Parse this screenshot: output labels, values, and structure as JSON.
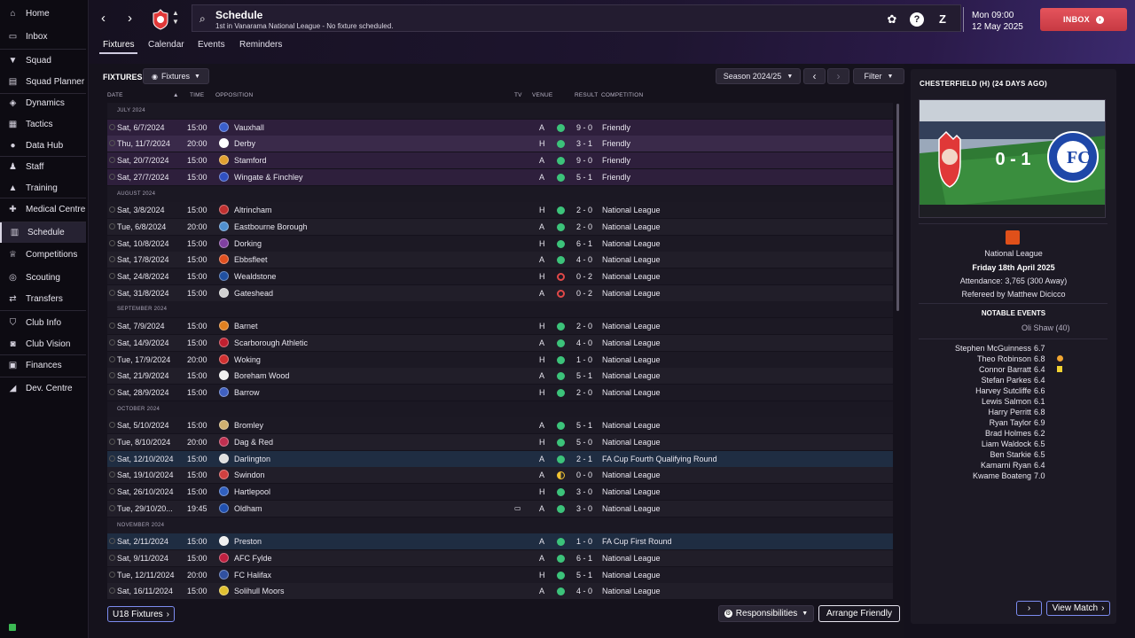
{
  "sidebar": {
    "items": [
      {
        "label": "Home",
        "icon": "home-icon",
        "glyph": "⌂"
      },
      {
        "label": "Inbox",
        "icon": "inbox-icon",
        "glyph": "▭"
      },
      {
        "label": "Squad",
        "icon": "shirt-icon",
        "glyph": "▼"
      },
      {
        "label": "Squad Planner",
        "icon": "clipboard-icon",
        "glyph": "▤"
      },
      {
        "label": "Dynamics",
        "icon": "dynamics-icon",
        "glyph": "◈"
      },
      {
        "label": "Tactics",
        "icon": "tactics-icon",
        "glyph": "▦"
      },
      {
        "label": "Data Hub",
        "icon": "data-hub-icon",
        "glyph": "●"
      },
      {
        "label": "Staff",
        "icon": "staff-icon",
        "glyph": "♟"
      },
      {
        "label": "Training",
        "icon": "training-icon",
        "glyph": "▲"
      },
      {
        "label": "Medical Centre",
        "icon": "medical-icon",
        "glyph": "✚"
      },
      {
        "label": "Schedule",
        "icon": "calendar-icon",
        "glyph": "▥"
      },
      {
        "label": "Competitions",
        "icon": "trophy-icon",
        "glyph": "♕"
      },
      {
        "label": "Scouting",
        "icon": "scouting-icon",
        "glyph": "◎"
      },
      {
        "label": "Transfers",
        "icon": "transfers-icon",
        "glyph": "⇄"
      },
      {
        "label": "Club Info",
        "icon": "shield-icon",
        "glyph": "⛉"
      },
      {
        "label": "Club Vision",
        "icon": "vision-icon",
        "glyph": "◙"
      },
      {
        "label": "Finances",
        "icon": "finances-icon",
        "glyph": "▣"
      },
      {
        "label": "Dev. Centre",
        "icon": "dev-centre-icon",
        "glyph": "◢"
      }
    ]
  },
  "header": {
    "title": "Schedule",
    "subtitle": "1st in Vanarama National League - No fixture scheduled.",
    "day_time": "Mon 09:00",
    "date": "12 May 2025",
    "inbox_label": "INBOX",
    "tabs": [
      "Fixtures",
      "Calendar",
      "Events",
      "Reminders"
    ]
  },
  "toolbar": {
    "section_label": "FIXTURES",
    "view_dropdown": "Fixtures",
    "season": "Season 2024/25",
    "filter": "Filter"
  },
  "columns": {
    "date": "DATE",
    "time": "TIME",
    "opposition": "OPPOSITION",
    "tv": "TV",
    "venue": "VENUE",
    "result": "RESULT",
    "competition": "COMPETITION"
  },
  "fixtures": [
    {
      "month": "JULY 2024"
    },
    {
      "date": "Sat, 6/7/2024",
      "time": "15:00",
      "opp": "Vauxhall",
      "venue": "A",
      "res": "W",
      "score": "9 - 0",
      "comp": "Friendly",
      "style": "friendly",
      "color": "#3a5fcc"
    },
    {
      "date": "Thu, 11/7/2024",
      "time": "20:00",
      "opp": "Derby",
      "venue": "H",
      "res": "W",
      "score": "3 - 1",
      "comp": "Friendly",
      "style": "friendly2",
      "color": "#ffffff"
    },
    {
      "date": "Sat, 20/7/2024",
      "time": "15:00",
      "opp": "Stamford",
      "venue": "A",
      "res": "W",
      "score": "9 - 0",
      "comp": "Friendly",
      "style": "friendly",
      "color": "#e0a030"
    },
    {
      "date": "Sat, 27/7/2024",
      "time": "15:00",
      "opp": "Wingate & Finchley",
      "venue": "A",
      "res": "W",
      "score": "5 - 1",
      "comp": "Friendly",
      "style": "friendly",
      "color": "#3050c0"
    },
    {
      "month": "AUGUST 2024"
    },
    {
      "date": "Sat, 3/8/2024",
      "time": "15:00",
      "opp": "Altrincham",
      "venue": "H",
      "res": "W",
      "score": "2 - 0",
      "comp": "National League",
      "style": "dark",
      "color": "#c03030"
    },
    {
      "date": "Tue, 6/8/2024",
      "time": "20:00",
      "opp": "Eastbourne Borough",
      "venue": "A",
      "res": "W",
      "score": "2 - 0",
      "comp": "National League",
      "style": "alt",
      "color": "#5090d0"
    },
    {
      "date": "Sat, 10/8/2024",
      "time": "15:00",
      "opp": "Dorking",
      "venue": "H",
      "res": "W",
      "score": "6 - 1",
      "comp": "National League",
      "style": "dark",
      "color": "#8040a0"
    },
    {
      "date": "Sat, 17/8/2024",
      "time": "15:00",
      "opp": "Ebbsfleet",
      "venue": "A",
      "res": "W",
      "score": "4 - 0",
      "comp": "National League",
      "style": "alt",
      "color": "#e05020"
    },
    {
      "date": "Sat, 24/8/2024",
      "time": "15:00",
      "opp": "Wealdstone",
      "venue": "H",
      "res": "L",
      "score": "0 - 2",
      "comp": "National League",
      "style": "dark",
      "color": "#2050a0"
    },
    {
      "date": "Sat, 31/8/2024",
      "time": "15:00",
      "opp": "Gateshead",
      "venue": "A",
      "res": "L",
      "score": "0 - 2",
      "comp": "National League",
      "style": "alt",
      "color": "#d0d0d0"
    },
    {
      "month": "SEPTEMBER 2024"
    },
    {
      "date": "Sat, 7/9/2024",
      "time": "15:00",
      "opp": "Barnet",
      "venue": "H",
      "res": "W",
      "score": "2 - 0",
      "comp": "National League",
      "style": "dark",
      "color": "#e08020"
    },
    {
      "date": "Sat, 14/9/2024",
      "time": "15:00",
      "opp": "Scarborough Athletic",
      "venue": "A",
      "res": "W",
      "score": "4 - 0",
      "comp": "National League",
      "style": "alt",
      "color": "#c02030"
    },
    {
      "date": "Tue, 17/9/2024",
      "time": "20:00",
      "opp": "Woking",
      "venue": "H",
      "res": "W",
      "score": "1 - 0",
      "comp": "National League",
      "style": "dark",
      "color": "#d03030"
    },
    {
      "date": "Sat, 21/9/2024",
      "time": "15:00",
      "opp": "Boreham Wood",
      "venue": "A",
      "res": "W",
      "score": "5 - 1",
      "comp": "National League",
      "style": "alt",
      "color": "#f0f0f0"
    },
    {
      "date": "Sat, 28/9/2024",
      "time": "15:00",
      "opp": "Barrow",
      "venue": "H",
      "res": "W",
      "score": "2 - 0",
      "comp": "National League",
      "style": "dark",
      "color": "#4060c0"
    },
    {
      "month": "OCTOBER 2024"
    },
    {
      "date": "Sat, 5/10/2024",
      "time": "15:00",
      "opp": "Bromley",
      "venue": "A",
      "res": "W",
      "score": "5 - 1",
      "comp": "National League",
      "style": "dark",
      "color": "#d0b070"
    },
    {
      "date": "Tue, 8/10/2024",
      "time": "20:00",
      "opp": "Dag & Red",
      "venue": "H",
      "res": "W",
      "score": "5 - 0",
      "comp": "National League",
      "style": "alt",
      "color": "#c03050"
    },
    {
      "date": "Sat, 12/10/2024",
      "time": "15:00",
      "opp": "Darlington",
      "venue": "A",
      "res": "W",
      "score": "2 - 1",
      "comp": "FA Cup Fourth Qualifying Round",
      "style": "cup",
      "color": "#e0e0e0"
    },
    {
      "date": "Sat, 19/10/2024",
      "time": "15:00",
      "opp": "Swindon",
      "venue": "A",
      "res": "D",
      "score": "0 - 0",
      "comp": "National League",
      "style": "alt",
      "color": "#d04040"
    },
    {
      "date": "Sat, 26/10/2024",
      "time": "15:00",
      "opp": "Hartlepool",
      "venue": "H",
      "res": "W",
      "score": "3 - 0",
      "comp": "National League",
      "style": "dark",
      "color": "#3060c0"
    },
    {
      "date": "Tue, 29/10/20...",
      "time": "19:45",
      "opp": "Oldham",
      "venue": "A",
      "res": "W",
      "score": "3 - 0",
      "comp": "National League",
      "style": "alt",
      "color": "#2050b0",
      "tv": true
    },
    {
      "month": "NOVEMBER 2024"
    },
    {
      "date": "Sat, 2/11/2024",
      "time": "15:00",
      "opp": "Preston",
      "venue": "A",
      "res": "W",
      "score": "1 - 0",
      "comp": "FA Cup First Round",
      "style": "cup",
      "color": "#f0f0f0"
    },
    {
      "date": "Sat, 9/11/2024",
      "time": "15:00",
      "opp": "AFC Fylde",
      "venue": "A",
      "res": "W",
      "score": "6 - 1",
      "comp": "National League",
      "style": "alt",
      "color": "#c02040"
    },
    {
      "date": "Tue, 12/11/2024",
      "time": "20:00",
      "opp": "FC Halifax",
      "venue": "H",
      "res": "W",
      "score": "5 - 1",
      "comp": "National League",
      "style": "dark",
      "color": "#3050a0"
    },
    {
      "date": "Sat, 16/11/2024",
      "time": "15:00",
      "opp": "Solihull Moors",
      "venue": "A",
      "res": "W",
      "score": "4 - 0",
      "comp": "National League",
      "style": "alt",
      "color": "#e0c030"
    }
  ],
  "bottom": {
    "u18": "U18 Fixtures",
    "responsibilities": "Responsibilities",
    "arrange": "Arrange Friendly"
  },
  "panel": {
    "title": "CHESTERFIELD (H) (24 DAYS AGO)",
    "score": "0 - 1",
    "competition": "National League",
    "match_date": "Friday 18th April 2025",
    "attendance": "Attendance: 3,765 (300 Away)",
    "referee": "Refereed by  Matthew Dicicco",
    "notable_label": "NOTABLE EVENTS",
    "notable_event": "Oli Shaw (40)",
    "ratings": [
      {
        "name": "Stephen McGuinness",
        "rating": "6.7"
      },
      {
        "name": "Theo Robinson",
        "rating": "6.8",
        "event": "sub"
      },
      {
        "name": "Connor Barratt",
        "rating": "6.4",
        "event": "yellow"
      },
      {
        "name": "Stefan Parkes",
        "rating": "6.4"
      },
      {
        "name": "Harvey Sutcliffe",
        "rating": "6.6"
      },
      {
        "name": "Lewis Salmon",
        "rating": "6.1"
      },
      {
        "name": "Harry Perritt",
        "rating": "6.8"
      },
      {
        "name": "Ryan Taylor",
        "rating": "6.9"
      },
      {
        "name": "Brad Holmes",
        "rating": "6.2"
      },
      {
        "name": "Liam Waldock",
        "rating": "6.5"
      },
      {
        "name": "Ben Starkie",
        "rating": "6.5"
      },
      {
        "name": "Kamarni Ryan",
        "rating": "6.4"
      },
      {
        "name": "Kwame Boateng",
        "rating": "7.0"
      }
    ],
    "view_match": "View Match"
  },
  "colors": {
    "accent": "#d9464f",
    "win": "#3cc37a",
    "loss": "#e04848",
    "draw": "#f1c232"
  }
}
